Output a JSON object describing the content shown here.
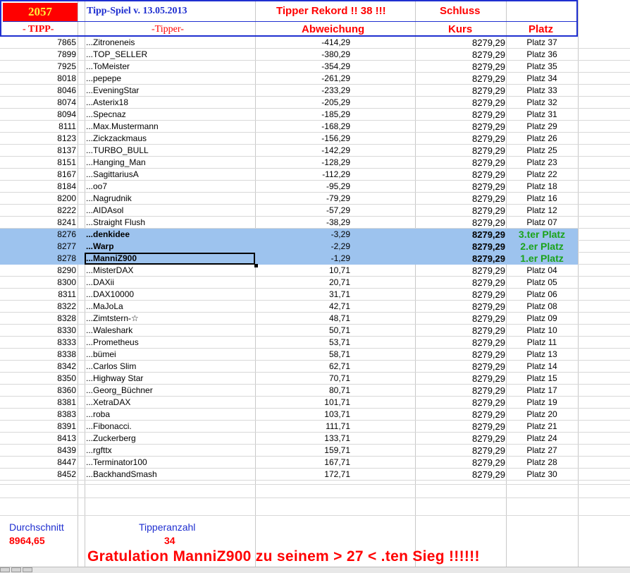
{
  "header": {
    "badge": "2057",
    "title": "Tipp-Spiel v. 13.05.2013",
    "record": "Tipper Rekord !!  38  !!!",
    "schluss": "Schluss",
    "col_tipp": "- TIPP-",
    "col_tipper": "-Tipper-",
    "col_abweichung": "Abweichung",
    "col_kurs": "Kurs",
    "col_platz": "Platz"
  },
  "colors": {
    "header_border": "#1f2fd0",
    "header_red": "#ff0000",
    "badge_text": "#ffef3a",
    "highlight": "#9dc3ee",
    "winner_green": "#1aa31a"
  },
  "rows": [
    {
      "tipp": "7865",
      "name": "...Zitroneneis",
      "dev": "-414,29",
      "kurs": "8279,29",
      "platz": "Platz 37"
    },
    {
      "tipp": "7899",
      "name": "...TOP_SELLER",
      "dev": "-380,29",
      "kurs": "8279,29",
      "platz": "Platz 36"
    },
    {
      "tipp": "7925",
      "name": "...ToMeister",
      "dev": "-354,29",
      "kurs": "8279,29",
      "platz": "Platz 35"
    },
    {
      "tipp": "8018",
      "name": "...pepepe",
      "dev": "-261,29",
      "kurs": "8279,29",
      "platz": "Platz 34"
    },
    {
      "tipp": "8046",
      "name": "...EveningStar",
      "dev": "-233,29",
      "kurs": "8279,29",
      "platz": "Platz 33"
    },
    {
      "tipp": "8074",
      "name": "...Asterix18",
      "dev": "-205,29",
      "kurs": "8279,29",
      "platz": "Platz 32"
    },
    {
      "tipp": "8094",
      "name": "...Specnaz",
      "dev": "-185,29",
      "kurs": "8279,29",
      "platz": "Platz 31"
    },
    {
      "tipp": "8111",
      "name": "...Max.Mustermann",
      "dev": "-168,29",
      "kurs": "8279,29",
      "platz": "Platz 29"
    },
    {
      "tipp": "8123",
      "name": "...Zickzackmaus",
      "dev": "-156,29",
      "kurs": "8279,29",
      "platz": "Platz 26"
    },
    {
      "tipp": "8137",
      "name": "...TURBO_BULL",
      "dev": "-142,29",
      "kurs": "8279,29",
      "platz": "Platz 25"
    },
    {
      "tipp": "8151",
      "name": "...Hanging_Man",
      "dev": "-128,29",
      "kurs": "8279,29",
      "platz": "Platz 23"
    },
    {
      "tipp": "8167",
      "name": "...SagittariusA",
      "dev": "-112,29",
      "kurs": "8279,29",
      "platz": "Platz 22"
    },
    {
      "tipp": "8184",
      "name": "...oo7",
      "dev": "-95,29",
      "kurs": "8279,29",
      "platz": "Platz 18"
    },
    {
      "tipp": "8200",
      "name": "...Nagrudnik",
      "dev": "-79,29",
      "kurs": "8279,29",
      "platz": "Platz 16"
    },
    {
      "tipp": "8222",
      "name": "...AIDAsol",
      "dev": "-57,29",
      "kurs": "8279,29",
      "platz": "Platz 12"
    },
    {
      "tipp": "8241",
      "name": "...Straight Flush",
      "dev": "-38,29",
      "kurs": "8279,29",
      "platz": "Platz 07"
    },
    {
      "tipp": "8276",
      "name": "...denkidee",
      "dev": "-3,29",
      "kurs": "8279,29",
      "platz": "3.ter Platz",
      "hl": true
    },
    {
      "tipp": "8277",
      "name": "...Warp",
      "dev": "-2,29",
      "kurs": "8279,29",
      "platz": "2.er Platz",
      "hl": true
    },
    {
      "tipp": "8278",
      "name": "...ManniZ900",
      "dev": "-1,29",
      "kurs": "8279,29",
      "platz": "1.er Platz",
      "hl": true
    },
    {
      "tipp": "8290",
      "name": "...MisterDAX",
      "dev": "10,71",
      "kurs": "8279,29",
      "platz": "Platz 04"
    },
    {
      "tipp": "8300",
      "name": "...DAXii",
      "dev": "20,71",
      "kurs": "8279,29",
      "platz": "Platz 05"
    },
    {
      "tipp": "8311",
      "name": "...DAX10000",
      "dev": "31,71",
      "kurs": "8279,29",
      "platz": "Platz 06"
    },
    {
      "tipp": "8322",
      "name": "...MaJoLa",
      "dev": "42,71",
      "kurs": "8279,29",
      "platz": "Platz 08"
    },
    {
      "tipp": "8328",
      "name": "...Zimtstern-☆",
      "dev": "48,71",
      "kurs": "8279,29",
      "platz": "Platz 09"
    },
    {
      "tipp": "8330",
      "name": "...Waleshark",
      "dev": "50,71",
      "kurs": "8279,29",
      "platz": "Platz 10"
    },
    {
      "tipp": "8333",
      "name": "...Prometheus",
      "dev": "53,71",
      "kurs": "8279,29",
      "platz": "Platz 11"
    },
    {
      "tipp": "8338",
      "name": "...bümei",
      "dev": "58,71",
      "kurs": "8279,29",
      "platz": "Platz 13"
    },
    {
      "tipp": "8342",
      "name": "...Carlos Slim",
      "dev": "62,71",
      "kurs": "8279,29",
      "platz": "Platz 14"
    },
    {
      "tipp": "8350",
      "name": "...Highway Star",
      "dev": "70,71",
      "kurs": "8279,29",
      "platz": "Platz 15"
    },
    {
      "tipp": "8360",
      "name": "...Georg_Büchner",
      "dev": "80,71",
      "kurs": "8279,29",
      "platz": "Platz 17"
    },
    {
      "tipp": "8381",
      "name": "...XetraDAX",
      "dev": "101,71",
      "kurs": "8279,29",
      "platz": "Platz 19"
    },
    {
      "tipp": "8383",
      "name": "...roba",
      "dev": "103,71",
      "kurs": "8279,29",
      "platz": "Platz 20"
    },
    {
      "tipp": "8391",
      "name": "...Fibonacci.",
      "dev": "111,71",
      "kurs": "8279,29",
      "platz": "Platz 21"
    },
    {
      "tipp": "8413",
      "name": "...Zuckerberg",
      "dev": "133,71",
      "kurs": "8279,29",
      "platz": "Platz 24"
    },
    {
      "tipp": "8439",
      "name": "...rgfttx",
      "dev": "159,71",
      "kurs": "8279,29",
      "platz": "Platz 27"
    },
    {
      "tipp": "8447",
      "name": "...Terminator100",
      "dev": "167,71",
      "kurs": "8279,29",
      "platz": "Platz 28"
    },
    {
      "tipp": "8452",
      "name": "...BackhandSmash",
      "dev": "172,71",
      "kurs": "8279,29",
      "platz": "Platz 30"
    }
  ],
  "footer": {
    "durchschnitt_label": "Durchschnitt",
    "durchschnitt_value": "8964,65",
    "tipperanzahl_label": "Tipperanzahl",
    "tipperanzahl_value": "34",
    "gratulation": "Gratulation  ManniZ900  zu seinem > 27 < .ten Sieg !!!!!!"
  }
}
